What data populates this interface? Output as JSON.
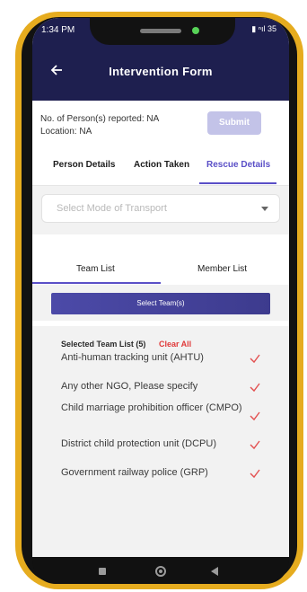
{
  "status_bar": {
    "time": "1:34 PM",
    "icons": "▮ ⁿıl 35"
  },
  "header": {
    "title": "Intervention Form",
    "back_icon": "arrow-left-icon"
  },
  "info": {
    "persons_reported": "No. of Person(s) reported: NA",
    "location": "Location: NA",
    "submit_label": "Submit"
  },
  "tabs": [
    {
      "label": "Person Details"
    },
    {
      "label": "Action Taken"
    },
    {
      "label": "Rescue Details",
      "active": true
    }
  ],
  "transport": {
    "placeholder": "Select Mode of Transport"
  },
  "list_tabs": [
    {
      "label": "Team List",
      "active": true
    },
    {
      "label": "Member List"
    }
  ],
  "select_teams_label": "Select Team(s)",
  "team_list": {
    "heading": "Selected Team List (5)",
    "clear_all": "Clear All",
    "items": [
      "Anti-human tracking unit (AHTU)",
      "Any other NGO, Please specify",
      "Child marriage prohibition officer (CMPO)",
      "District child protection unit (DCPU)",
      "Government railway police (GRP)"
    ]
  },
  "colors": {
    "header_bg": "#1e1f4f",
    "accent": "#5a4fc7",
    "frame": "#e6ac1f",
    "check": "#e35050",
    "clear_all": "#e03a3a"
  }
}
